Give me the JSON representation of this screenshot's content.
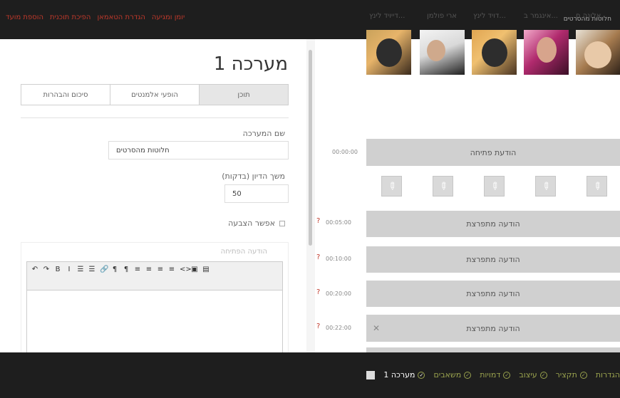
{
  "top": {
    "links": [
      "הוספת מועד",
      "הפיכת תוכנית",
      "הגדרת הטאמאן",
      "יומן ומגיעה"
    ],
    "user": "חלוטות מהסרטים"
  },
  "panel": {
    "title": "מערכה 1",
    "tabs": [
      "תוכן",
      "הופעי אלמנטים",
      "סיכום והבהרות"
    ],
    "name_label": "שם המערכה",
    "name_value": "חלוטות מהסרטים",
    "duration_label": "משך הדיון (בדקות)",
    "duration_value": "50",
    "checkbox_label": "אפשר הצבעה",
    "editor_label": "הודעה הפתיחה",
    "toolbar": [
      "↶",
      "↷",
      "B",
      "I",
      "☰",
      "☰",
      "🔗",
      "¶",
      "¶",
      "≡",
      "≡",
      "≡",
      "≡",
      "<>",
      "▣",
      "▤"
    ]
  },
  "avatars": [
    {
      "name": "אלונה ח..."
    },
    {
      "name": "אינגמר ב..."
    },
    {
      "name": "דויד לינץ..."
    },
    {
      "name": "ארי פולמן"
    },
    {
      "name": "דייויד לינץ..."
    }
  ],
  "timeline": {
    "opening": {
      "label": "הודעת פתיחה",
      "time": "00:00:00"
    },
    "items": [
      {
        "label": "הודעה מתפרצת",
        "time": "00:05:00"
      },
      {
        "label": "הודעה מתפרצת",
        "time": "00:10:00"
      },
      {
        "label": "הודעה מתפרצת",
        "time": "00:20:00"
      },
      {
        "label": "הודעה מתפרצת",
        "time": "00:22:00"
      }
    ]
  },
  "bottom": {
    "nav": [
      "הגדרות",
      "תקציר",
      "עיצוב",
      "דמויות",
      "משאבים",
      "מערכה 1"
    ]
  },
  "colors": {
    "accent_red": "#c0392b",
    "accent_green": "#9aa34e",
    "bar_gray": "#d0d0d0",
    "dark_bg": "#1e1e1e"
  }
}
